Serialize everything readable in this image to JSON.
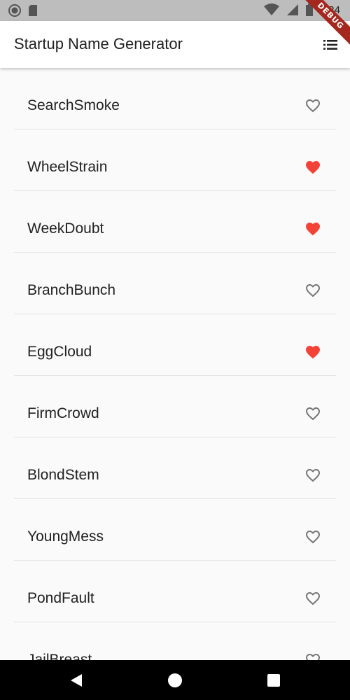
{
  "status_bar": {
    "time": "8:24",
    "icons": [
      "record-icon",
      "sd-card-icon",
      "wifi-icon",
      "signal-icon",
      "battery-icon"
    ]
  },
  "debug_banner": "DEBUG",
  "app_bar": {
    "title": "Startup Name Generator",
    "action_icon": "list-icon"
  },
  "colors": {
    "favorite": "#f44336",
    "unfavorite": "#757575"
  },
  "items": [
    {
      "name": "SearchSmoke",
      "saved": false
    },
    {
      "name": "WheelStrain",
      "saved": true
    },
    {
      "name": "WeekDoubt",
      "saved": true
    },
    {
      "name": "BranchBunch",
      "saved": false
    },
    {
      "name": "EggCloud",
      "saved": true
    },
    {
      "name": "FirmCrowd",
      "saved": false
    },
    {
      "name": "BlondStem",
      "saved": false
    },
    {
      "name": "YoungMess",
      "saved": false
    },
    {
      "name": "PondFault",
      "saved": false
    },
    {
      "name": "JailBreast",
      "saved": false
    }
  ],
  "nav_bar": {
    "buttons": [
      "back-icon",
      "home-icon",
      "recents-icon"
    ]
  }
}
